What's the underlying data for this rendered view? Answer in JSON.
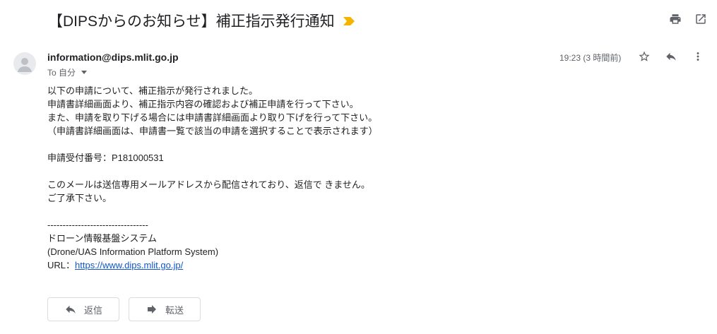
{
  "subject": {
    "text": "【DIPSからのお知らせ】補正指示発行通知",
    "importance_icon": "important-marker-icon",
    "importance_color": "#f4b400"
  },
  "toolbar": {
    "print_icon": "print-icon",
    "open_new_window_icon": "open-in-new-window-icon"
  },
  "message": {
    "sender": "information@dips.mlit.go.jp",
    "to_label": "To 自分",
    "timestamp": "19:23 (3 時間前)",
    "icons": {
      "star": "star-icon",
      "reply": "reply-icon",
      "more": "more-vert-icon"
    },
    "body": {
      "line1": "以下の申請について、補正指示が発行されました。",
      "line2": "申請書詳細画面より、補正指示内容の確認および補正申請を行って下さい。",
      "line3": "また、申請を取り下げる場合には申請書詳細画面より取り下げを行って下さい。",
      "line4": "（申請書詳細画面は、申請書一覧で該当の申請を選択することで表示されます）",
      "receipt": "申請受付番号：P181000531",
      "notice1": "このメールは送信専用メールアドレスから配信されており、返信で きません。",
      "notice2": "ご了承下さい。",
      "divider": "---------------------------------",
      "system_name": "ドローン情報基盤システム",
      "system_name_en": "(Drone/UAS Information Platform System)",
      "url_label": "URL：",
      "url": "https://www.dips.mlit.go.jp/"
    }
  },
  "actions": {
    "reply_label": "返信",
    "forward_label": "転送"
  },
  "colors": {
    "link": "#1155cc",
    "icon": "#5f6368"
  }
}
